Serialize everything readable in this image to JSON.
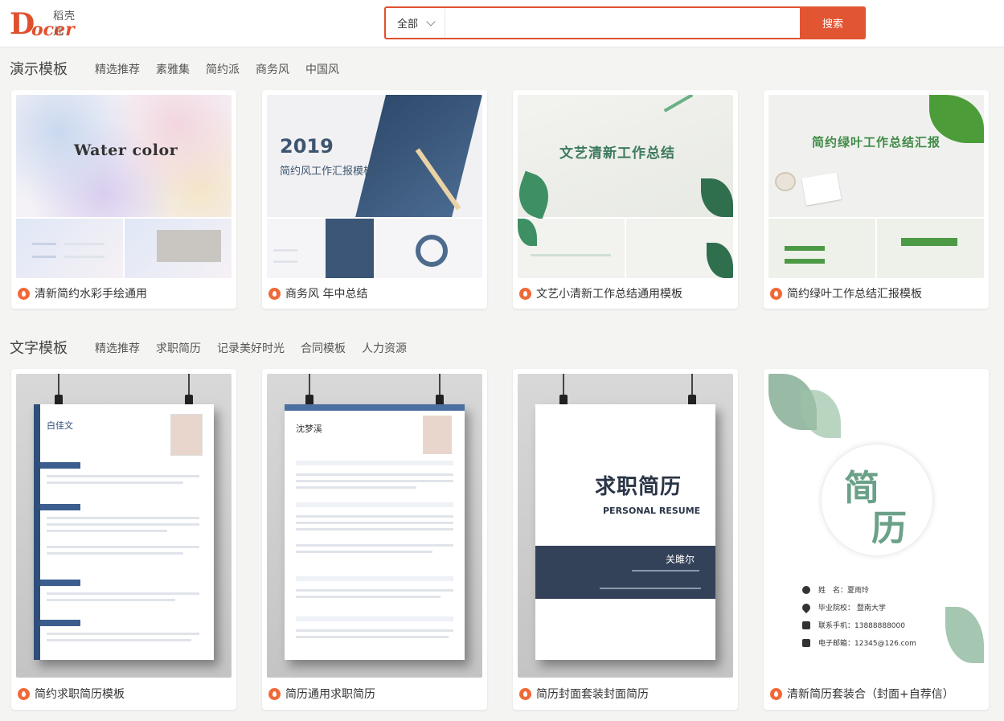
{
  "header": {
    "logo_small": "稻壳儿",
    "logo_d": "D",
    "logo_rest": "ocer",
    "search_scope": "全部",
    "search_placeholder": "",
    "search_button": "搜索"
  },
  "sections": [
    {
      "title": "演示模板",
      "tabs": [
        "精选推荐",
        "素雅集",
        "简约派",
        "商务风",
        "中国风"
      ],
      "cards": [
        {
          "label": "清新简约水彩手绘通用",
          "thumb_title": "Water color"
        },
        {
          "label": "商务风 年中总结",
          "thumb_year": "2019",
          "thumb_title": "简约风工作汇报模板"
        },
        {
          "label": "文艺小清新工作总结通用模板",
          "thumb_title": "文艺清新工作总结"
        },
        {
          "label": "简约绿叶工作总结汇报模板",
          "thumb_title": "简约绿叶工作总结汇报"
        }
      ]
    },
    {
      "title": "文字模板",
      "tabs": [
        "精选推荐",
        "求职简历",
        "记录美好时光",
        "合同模板",
        "人力资源"
      ],
      "cards": [
        {
          "label": "简约求职简历模板",
          "thumb_name": "白佳文"
        },
        {
          "label": "简历通用求职简历",
          "thumb_name": "沈梦溪"
        },
        {
          "label": "简历封面套装封面简历",
          "thumb_title": "求职简历",
          "thumb_subtitle": "PERSONAL RESUME",
          "thumb_name": "关雎尔"
        },
        {
          "label": "清新简历套装合（封面+自荐信）",
          "thumb_char1": "简",
          "thumb_char2": "历",
          "thumb_name": "姓　名：夏雨玲",
          "thumb_school": "毕业院校：  暨南大学",
          "thumb_phone": "联系手机：13888888000",
          "thumb_email": "电子邮箱：12345@126.com"
        }
      ]
    }
  ],
  "colors": {
    "accent": "#e0502e",
    "background": "#f4f4f2",
    "fire_icon": "#f06a38"
  }
}
